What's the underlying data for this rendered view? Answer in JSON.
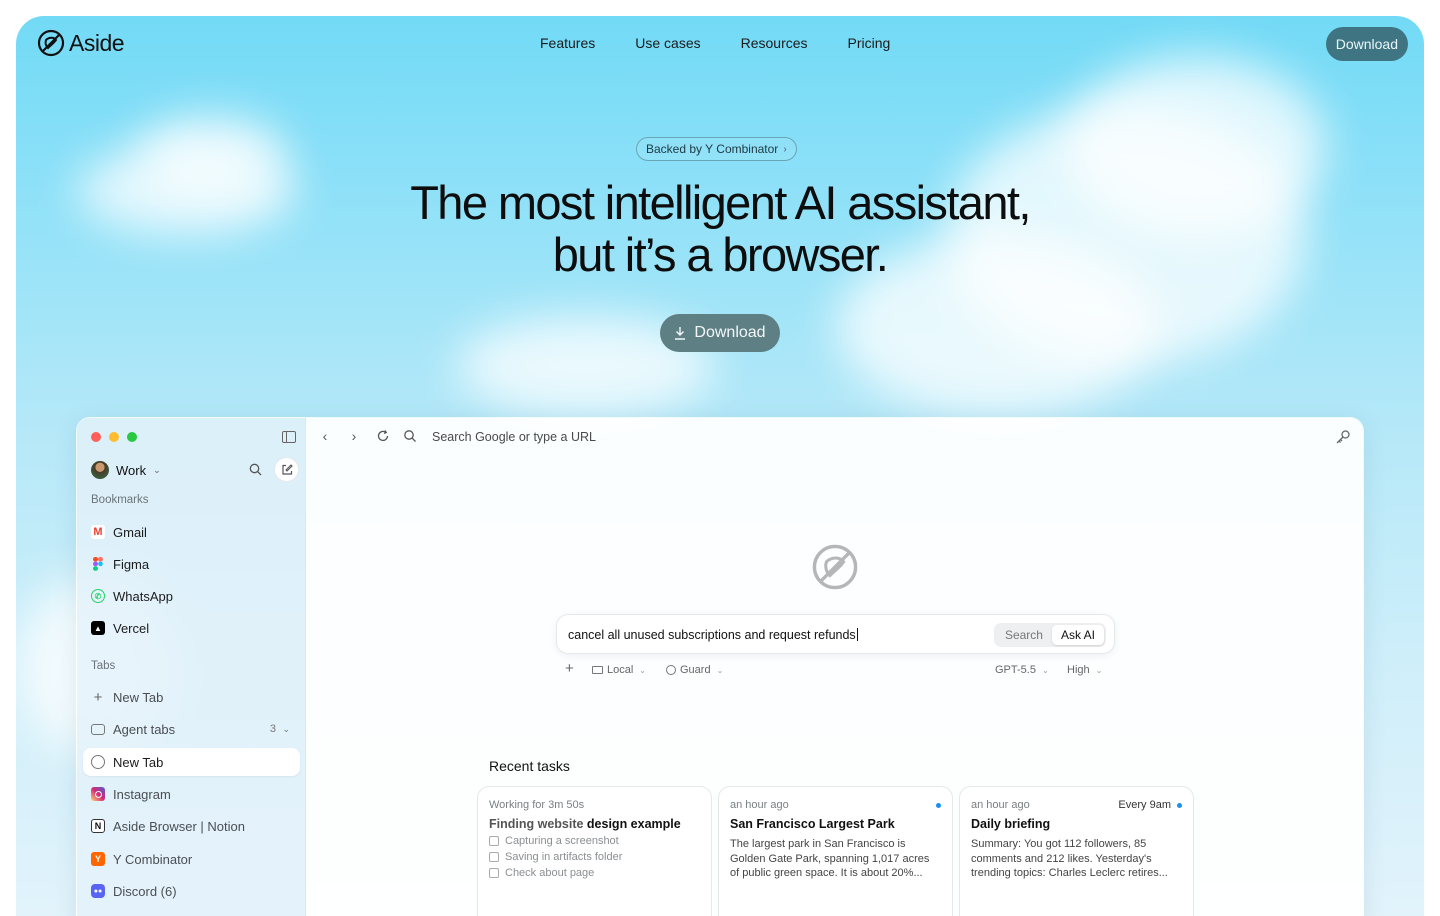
{
  "brand": {
    "name": "Aside"
  },
  "nav": {
    "links": [
      "Features",
      "Use cases",
      "Resources",
      "Pricing"
    ],
    "download_label": "Download"
  },
  "hero": {
    "badge": "Backed by Y Combinator",
    "title_line1": "The most intelligent AI assistant,",
    "title_line2": "but it’s a browser.",
    "download_label": "Download"
  },
  "app": {
    "sidebar": {
      "workspace": "Work",
      "bookmarks_label": "Bookmarks",
      "bookmarks": [
        {
          "label": "Gmail",
          "icon": "gmail-icon"
        },
        {
          "label": "Figma",
          "icon": "figma-icon"
        },
        {
          "label": "WhatsApp",
          "icon": "whatsapp-icon"
        },
        {
          "label": "Vercel",
          "icon": "vercel-icon"
        }
      ],
      "tabs_label": "Tabs",
      "tabs": [
        {
          "label": "New Tab",
          "icon": "plus-icon"
        },
        {
          "label": "Agent tabs",
          "icon": "folder-icon",
          "count": "3"
        },
        {
          "label": "New Tab",
          "icon": "aside-icon",
          "active": true
        },
        {
          "label": "Instagram",
          "icon": "instagram-icon"
        },
        {
          "label": "Aside Browser | Notion",
          "icon": "notion-icon"
        },
        {
          "label": "Y Combinator",
          "icon": "ycombinator-icon"
        },
        {
          "label": "Discord (6)",
          "icon": "discord-icon"
        }
      ]
    },
    "toolbar": {
      "url_placeholder": "Search Google or type a URL"
    },
    "prompt": {
      "text": "cancel all unused subscriptions and request refunds",
      "mode_search": "Search",
      "mode_ask": "Ask AI",
      "options": {
        "local": "Local",
        "guard": "Guard",
        "model": "GPT-5.5",
        "effort": "High"
      }
    },
    "recent": {
      "title": "Recent tasks",
      "cards": [
        {
          "meta": "Working for 3m 50s",
          "title_a": "Finding website ",
          "title_b": "design example",
          "steps": [
            "Capturing a screenshot",
            "Saving in artifacts folder",
            "Check about page"
          ]
        },
        {
          "meta": "an hour ago",
          "title": "San Francisco Largest Park",
          "body": "The largest park in San Francisco is Golden Gate Park, spanning 1,017 acres of public green space. It is about 20%..."
        },
        {
          "meta": "an hour ago",
          "schedule": "Every 9am",
          "title": "Daily briefing",
          "body": "Summary: You got 112 followers, 85 comments and 212 likes. Yesterday's trending topics: Charles Leclerc retires..."
        }
      ]
    }
  },
  "colors": {
    "sky_top": "#72daf6",
    "nav_download_bg": "#3f7582",
    "hero_download_bg": "#5e7f84",
    "unread_dot": "#1a8ff0"
  }
}
